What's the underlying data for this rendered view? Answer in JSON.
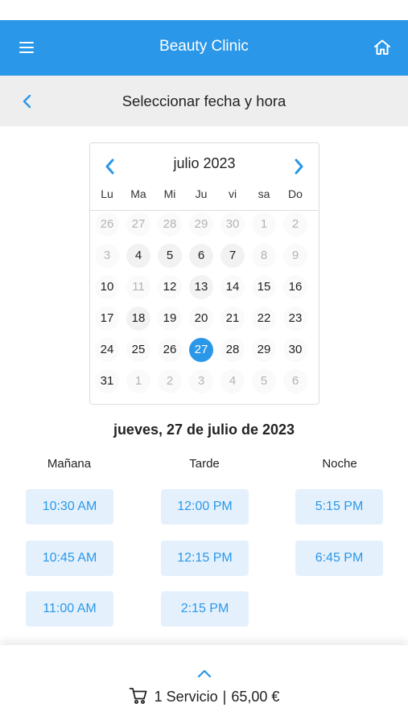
{
  "app": {
    "title": "Beauty Clinic",
    "accent": "#2b97e8"
  },
  "header": {
    "subtitle": "Seleccionar fecha y hora"
  },
  "calendar": {
    "month_label": "julio 2023",
    "weekdays": [
      "Lu",
      "Ma",
      "Mi",
      "Ju",
      "vi",
      "sa",
      "Do"
    ],
    "weeks": [
      [
        {
          "d": "26",
          "s": "muted"
        },
        {
          "d": "27",
          "s": "muted"
        },
        {
          "d": "28",
          "s": "muted"
        },
        {
          "d": "29",
          "s": "muted"
        },
        {
          "d": "30",
          "s": "muted"
        },
        {
          "d": "1",
          "s": "muted"
        },
        {
          "d": "2",
          "s": "muted"
        }
      ],
      [
        {
          "d": "3",
          "s": "muted"
        },
        {
          "d": "4",
          "s": "enabled"
        },
        {
          "d": "5",
          "s": "enabled"
        },
        {
          "d": "6",
          "s": "enabled"
        },
        {
          "d": "7",
          "s": "enabled"
        },
        {
          "d": "8",
          "s": "muted"
        },
        {
          "d": "9",
          "s": "muted"
        }
      ],
      [
        {
          "d": "10",
          "s": "normal"
        },
        {
          "d": "11",
          "s": "muted"
        },
        {
          "d": "12",
          "s": "normal"
        },
        {
          "d": "13",
          "s": "enabled"
        },
        {
          "d": "14",
          "s": "normal"
        },
        {
          "d": "15",
          "s": "normal"
        },
        {
          "d": "16",
          "s": "normal"
        }
      ],
      [
        {
          "d": "17",
          "s": "normal"
        },
        {
          "d": "18",
          "s": "enabled"
        },
        {
          "d": "19",
          "s": "normal"
        },
        {
          "d": "20",
          "s": "normal"
        },
        {
          "d": "21",
          "s": "normal"
        },
        {
          "d": "22",
          "s": "normal"
        },
        {
          "d": "23",
          "s": "normal"
        }
      ],
      [
        {
          "d": "24",
          "s": "normal"
        },
        {
          "d": "25",
          "s": "normal"
        },
        {
          "d": "26",
          "s": "normal"
        },
        {
          "d": "27",
          "s": "selected"
        },
        {
          "d": "28",
          "s": "normal"
        },
        {
          "d": "29",
          "s": "normal"
        },
        {
          "d": "30",
          "s": "normal"
        }
      ],
      [
        {
          "d": "31",
          "s": "normal"
        },
        {
          "d": "1",
          "s": "muted"
        },
        {
          "d": "2",
          "s": "muted"
        },
        {
          "d": "3",
          "s": "muted"
        },
        {
          "d": "4",
          "s": "muted"
        },
        {
          "d": "5",
          "s": "muted"
        },
        {
          "d": "6",
          "s": "muted"
        }
      ]
    ]
  },
  "selected_date_label": "jueves, 27 de julio de 2023",
  "slots": {
    "columns": [
      {
        "title": "Mañana",
        "times": [
          "10:30 AM",
          "10:45 AM",
          "11:00 AM"
        ]
      },
      {
        "title": "Tarde",
        "times": [
          "12:00 PM",
          "12:15 PM",
          "2:15 PM"
        ]
      },
      {
        "title": "Noche",
        "times": [
          "5:15 PM",
          "6:45 PM"
        ]
      }
    ]
  },
  "cart": {
    "services": "1 Servicio",
    "separator": "|",
    "total": "65,00 €"
  },
  "icons": {
    "menu": "hamburger-menu-icon",
    "home": "home-icon",
    "back": "chevron-left-icon",
    "prev_month": "chevron-left-icon",
    "next_month": "chevron-right-icon",
    "expand": "chevron-up-icon",
    "cart": "shopping-cart-icon"
  }
}
